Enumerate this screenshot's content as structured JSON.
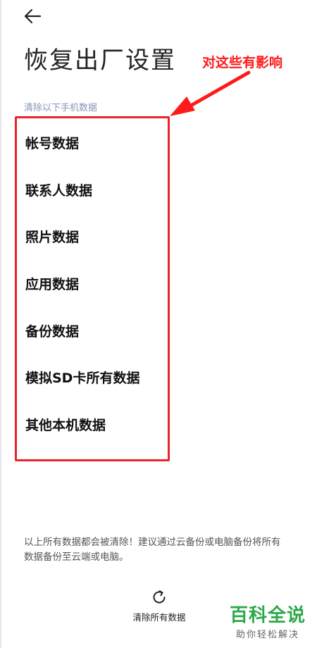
{
  "header": {
    "back_icon": "arrow-left-icon",
    "title": "恢复出厂设置"
  },
  "annotation": {
    "text": "对这些有影响",
    "color": "#ff1a1a"
  },
  "section": {
    "label": "清除以下手机数据",
    "items": [
      {
        "label": "帐号数据"
      },
      {
        "label": "联系人数据"
      },
      {
        "label": "照片数据"
      },
      {
        "label": "应用数据"
      },
      {
        "label": "备份数据"
      },
      {
        "label": "模拟SD卡所有数据"
      },
      {
        "label": "其他本机数据"
      }
    ]
  },
  "footer": {
    "warning": "以上所有数据都会被清除！建议通过云备份或电脑备份将所有数据备份至云端或电脑。",
    "reset_icon": "refresh-icon",
    "reset_label": "清除所有数据"
  },
  "watermark": {
    "title": "百科全说",
    "subtitle": "助你轻松解决",
    "color": "#2ea84a"
  }
}
